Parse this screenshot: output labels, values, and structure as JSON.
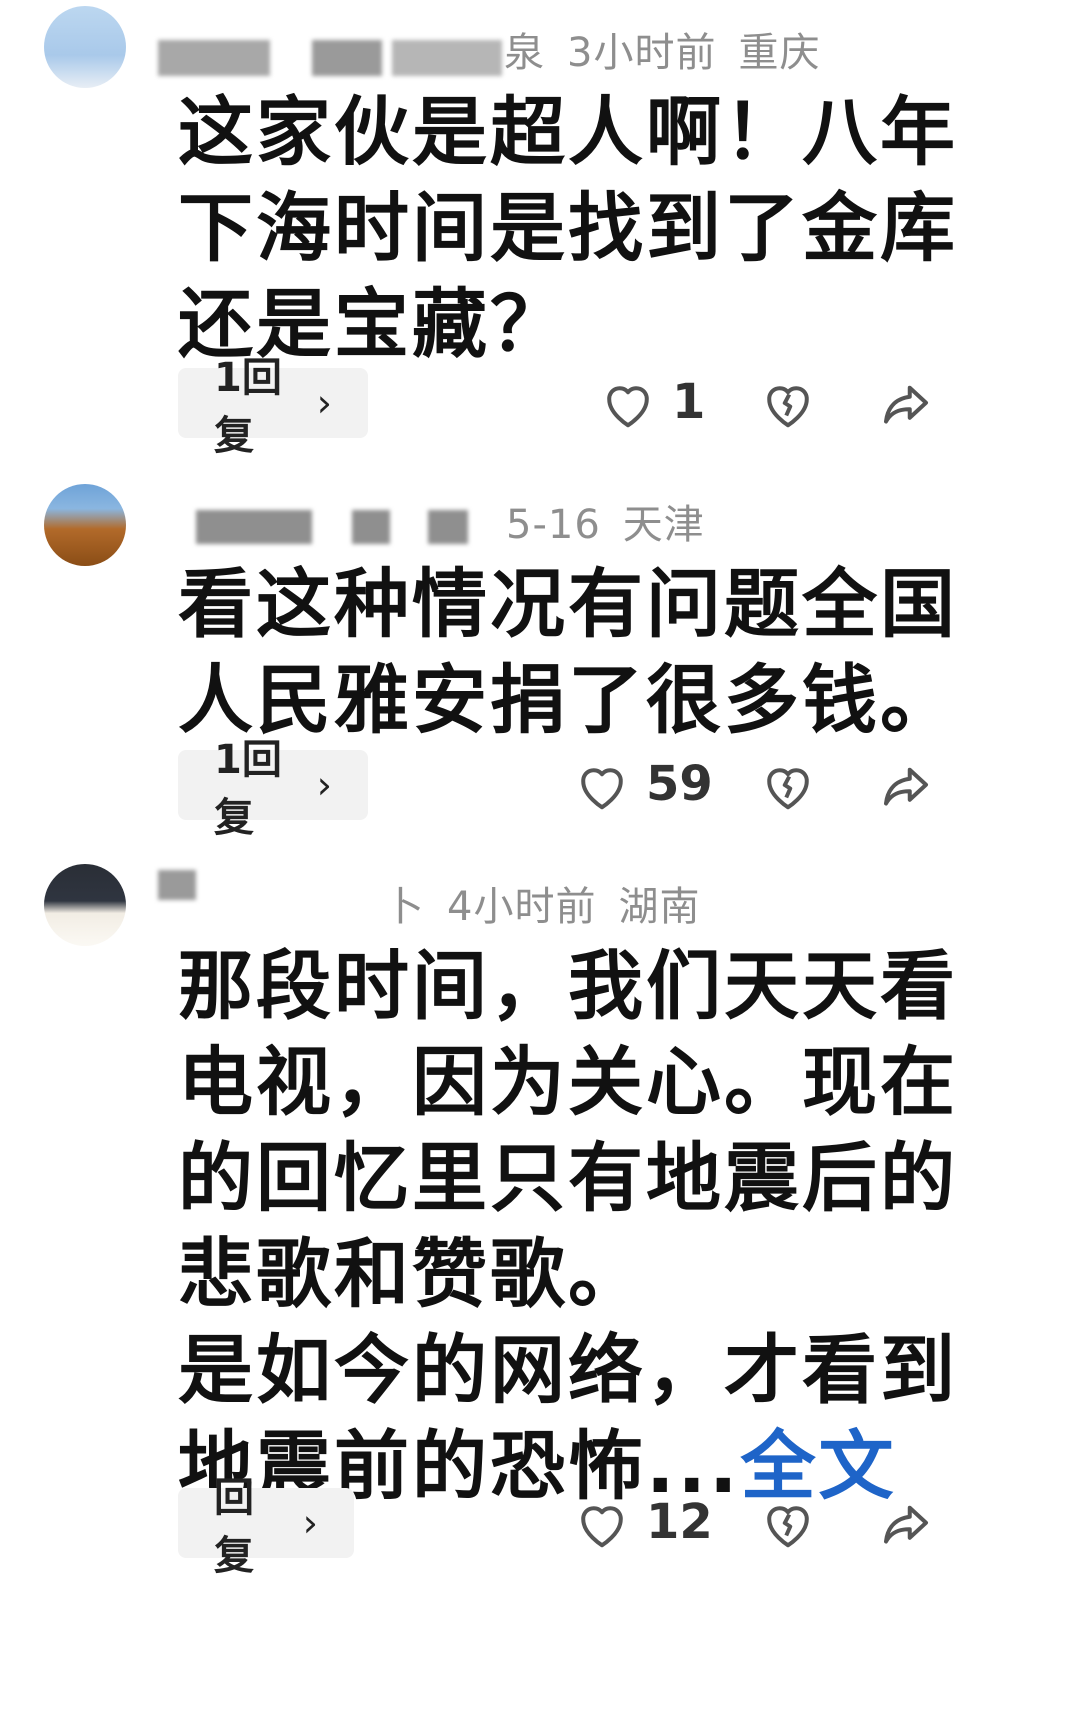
{
  "comments": [
    {
      "meta_tail": "泉",
      "time": "3小时前",
      "location": "重庆",
      "body_lines": [
        "这家伙是超人啊！八年下海时间是找到了金库还是宝藏？"
      ],
      "truncated_suffix": "",
      "full_text_link": "",
      "reply_label": "1回复",
      "like_count": "1"
    },
    {
      "meta_tail": "",
      "time": "5-16",
      "location": "天津",
      "body_lines": [
        "看这种情况有问题全国人民雅安捐了很多钱。"
      ],
      "truncated_suffix": "",
      "full_text_link": "",
      "reply_label": "1回复",
      "like_count": "59"
    },
    {
      "meta_tail": "卜",
      "time": "4小时前",
      "location": "湖南",
      "body_lines": [
        "那段时间，我们天天看电视，因为关心。现在的回忆里只有地震后的悲歌和赞歌。",
        "是如今的网络，才看到地震前的恐怖"
      ],
      "truncated_suffix": "...",
      "full_text_link": "全文",
      "reply_label": "回复",
      "like_count": "12"
    }
  ],
  "icons": {
    "like": "heart-outline-icon",
    "dislike": "broken-heart-icon",
    "share": "share-arrow-icon",
    "chevron": "chevron-right-icon"
  },
  "colors": {
    "meta_text": "#8e8e8e",
    "link": "#1e64c8",
    "pill_bg": "#f2f2f2"
  }
}
